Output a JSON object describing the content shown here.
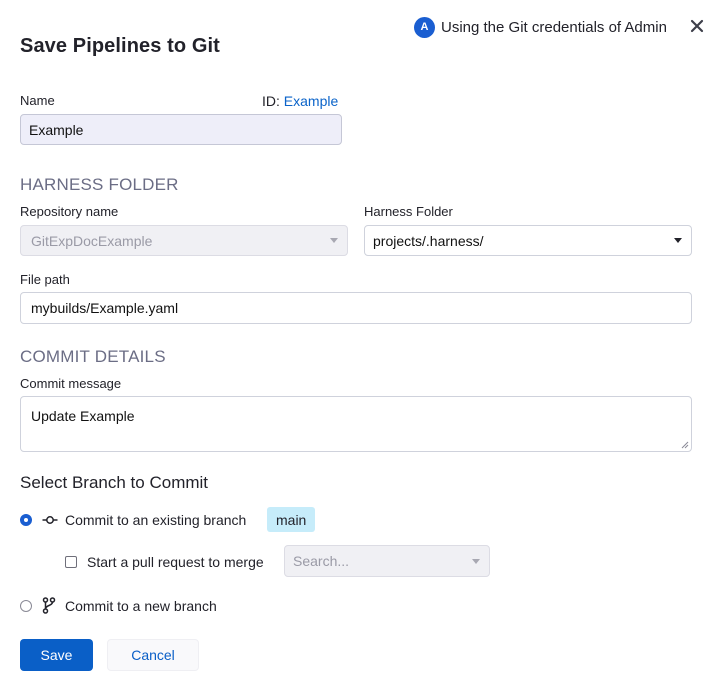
{
  "dialog": {
    "title": "Save Pipelines to Git",
    "credentials": {
      "avatar_letter": "A",
      "text": "Using the Git credentials of Admin"
    }
  },
  "name_field": {
    "label": "Name",
    "value": "Example",
    "id_label": "ID:",
    "id_value": "Example"
  },
  "harness_folder_section": {
    "heading": "HARNESS FOLDER",
    "repository": {
      "label": "Repository name",
      "value": "GitExpDocExample"
    },
    "folder": {
      "label": "Harness Folder",
      "value": "projects/.harness/"
    },
    "file_path": {
      "label": "File path",
      "value": "mybuilds/Example.yaml"
    }
  },
  "commit_section": {
    "heading": "COMMIT DETAILS",
    "message_label": "Commit message",
    "message_value": "Update Example"
  },
  "branch_section": {
    "heading": "Select Branch to Commit",
    "existing_option": {
      "label": "Commit to an existing branch",
      "branch": "main",
      "selected": true
    },
    "pull_request": {
      "label": "Start a pull request to merge",
      "checked": false,
      "search_placeholder": "Search..."
    },
    "new_option": {
      "label": "Commit to a new branch",
      "selected": false
    }
  },
  "actions": {
    "save_label": "Save",
    "cancel_label": "Cancel"
  },
  "colors": {
    "primary": "#0a5fc7",
    "avatar": "#1a5ed1",
    "branch_tag": "#c6ecfa",
    "section_heading": "#6b6d85"
  }
}
